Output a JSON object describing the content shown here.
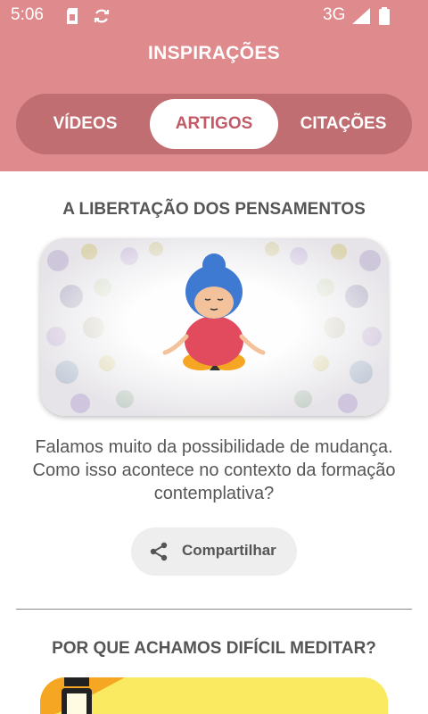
{
  "status_bar": {
    "time": "5:06",
    "network": "3G"
  },
  "header": {
    "title": "INSPIRAÇÕES"
  },
  "tabs": [
    {
      "label": "VÍDEOS",
      "selected": false
    },
    {
      "label": "ARTIGOS",
      "selected": true
    },
    {
      "label": "CITAÇÕES",
      "selected": false
    }
  ],
  "articles": [
    {
      "title": "A LIBERTAÇÃO DOS PENSAMENTOS",
      "summary": "Falamos muito da possibilidade de mudança. Como isso acontece no contexto da formação contemplativa?",
      "share_label": "Compartilhar",
      "image_icon": "meditating-woman-illustration"
    },
    {
      "title": "POR QUE ACHAMOS DIFÍCIL MEDITAR?",
      "image_icon": "lantern-illustration"
    }
  ],
  "colors": {
    "header": "#df8a8c",
    "tabbar": "#c06e71",
    "selected_tab_text": "#c15c66",
    "second_image_bg": "#f9ea62"
  }
}
